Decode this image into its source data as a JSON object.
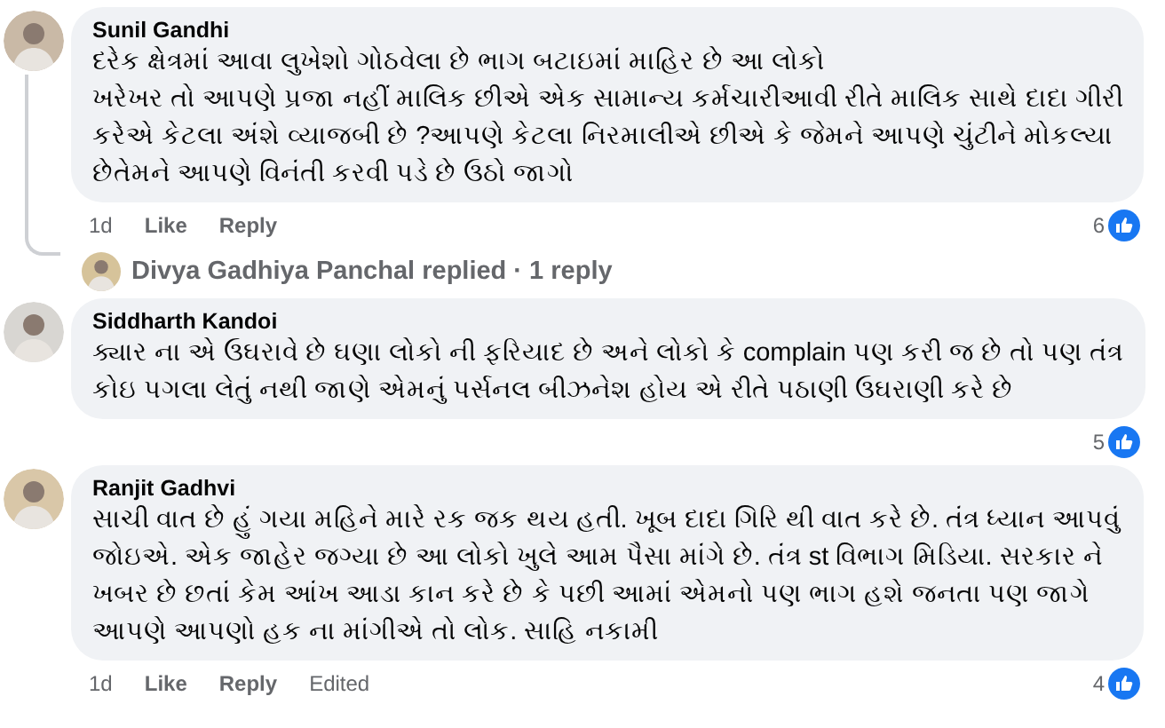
{
  "comments": [
    {
      "author": "Sunil Gandhi",
      "lines": [
        "દરેક ક્ષેત્રમાં આવા લુખેશો ગોઠવેલા છે ભાગ બટાઇમાં માહિર છે આ લોકો",
        "ખરેખર તો આપણે પ્રજા નહીં માલિક છીએ એક સામાન્ય કર્મચારીઆવી રીતે માલિક સાથે દાદા ગીરી",
        "કરેએ કેટલા અંશે વ્યાજબી છે ?આપણે કેટલા નિરમાલીએ છીએ કે જેમને આપણે ચુંટીને મોકલ્યા",
        "છેતેમને આપણે વિનંતી કરવી પડે છે ઉઠો જાગો"
      ],
      "time": "1d",
      "actions": [
        "Like",
        "Reply"
      ],
      "reactions": "6",
      "reply_summary": {
        "author": "Divya Gadhiya Panchal",
        "text": "replied · 1 reply"
      }
    },
    {
      "author": "Siddharth Kandoi",
      "lines": [
        "ક્યાર ના એ ઉઘરાવે છે ઘણા લોકો ની ફરિયાદ છે અને લોકો કે complain પણ કરી જ છે તો પણ તંત્ર",
        "કોઇ પગલા લેતું નથી જાણે એમનું પર્સનલ બીઝનેશ હોય એ રીતે પઠાણી ઉઘરાણી કરે છે"
      ],
      "reactions": "5"
    },
    {
      "author": "Ranjit Gadhvi",
      "lines": [
        "સાચી વાત છે હું ગયા મહિને મારે રક જક થય હતી. ખૂબ દાદા ગિરિ થી વાત કરે છે. તંત્ર ધ્યાન આપવું",
        "જોઇએ. એક જાહેર જગ્યા છે આ લોકો ખુલે આમ પૈસા માંગે છે. તંત્ર st વિભાગ મિડિયા. સરકાર ને",
        "ખબર છે છતાં કેમ આંખ આડા કાન કરે છે કે પછી આમાં એમનો પણ ભાગ હશે જનતા પણ જાગે",
        "આપણે આપણો હક ના માંગીએ તો લોક. સાહિ નકામી"
      ],
      "time": "1d",
      "actions": [
        "Like",
        "Reply"
      ],
      "edited": "Edited",
      "reactions": "4"
    }
  ]
}
